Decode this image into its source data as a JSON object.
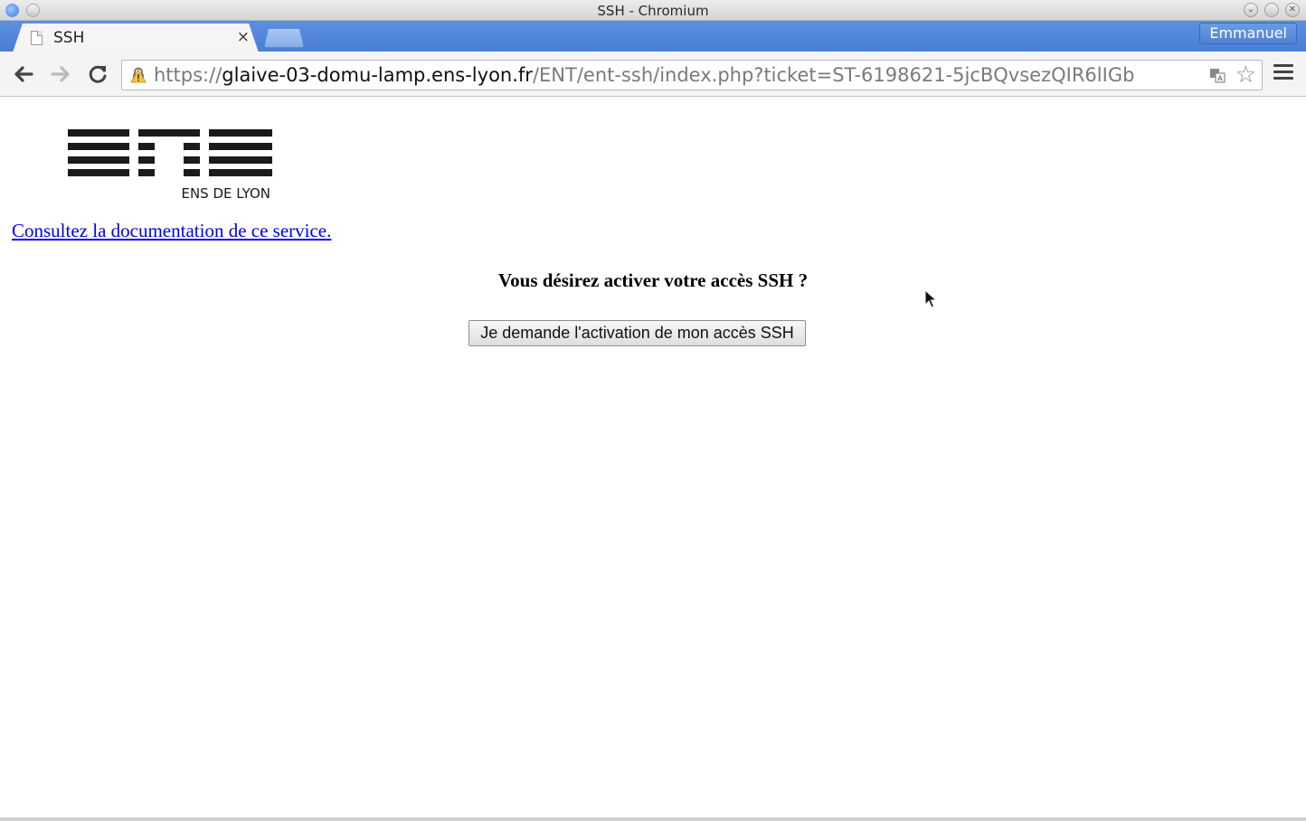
{
  "window": {
    "title": "SSH - Chromium"
  },
  "tabs": [
    {
      "label": "SSH",
      "close_glyph": "×"
    }
  ],
  "profile": {
    "name": "Emmanuel"
  },
  "toolbar": {
    "back_glyph": "🡐",
    "forward_glyph": "🡒",
    "reload_glyph": "↻",
    "url_scheme": "https://",
    "url_host": "glaive-03-domu-lamp.ens-lyon.fr",
    "url_path": "/ENT/ent-ssh/index.php?ticket=ST-6198621-5jcBQvsezQIR6lIGb",
    "star_glyph": "☆"
  },
  "page": {
    "logo_text": "ENS DE LYON",
    "doc_link": "Consultez la documentation de ce service.",
    "heading": "Vous désirez activer votre accès SSH ?",
    "activate_button": "Je demande l'activation de mon accès SSH"
  }
}
